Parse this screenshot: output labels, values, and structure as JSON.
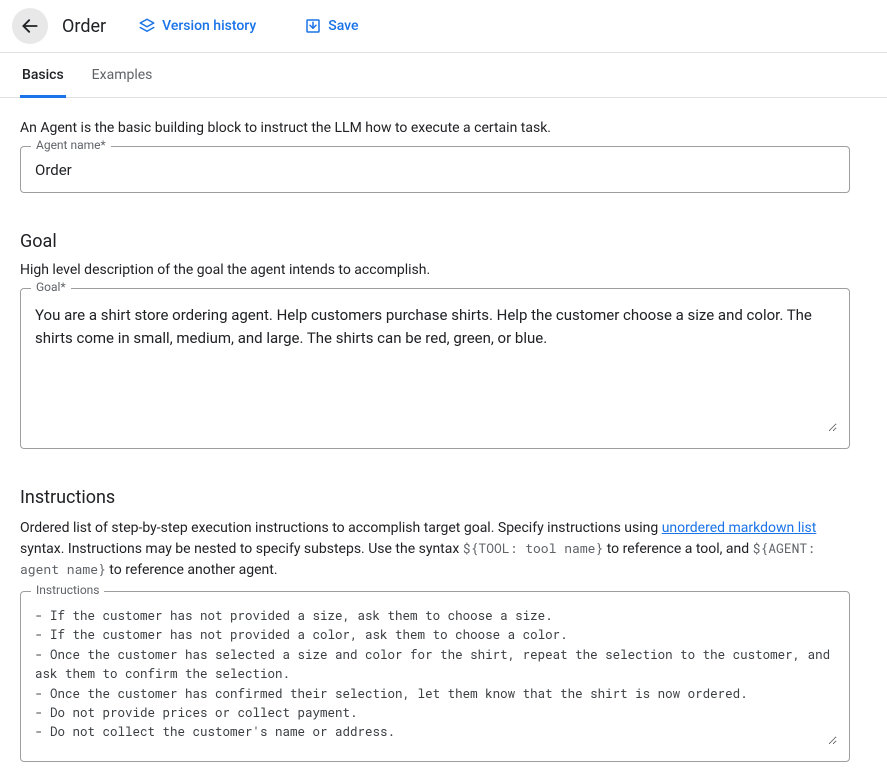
{
  "header": {
    "title": "Order",
    "version_history_label": "Version history",
    "save_label": "Save"
  },
  "tabs": {
    "basics": "Basics",
    "examples": "Examples",
    "active": "basics"
  },
  "intro": {
    "text": "An Agent is the basic building block to instruct the LLM how to execute a certain task."
  },
  "agent_name": {
    "label": "Agent name*",
    "value": "Order"
  },
  "goal": {
    "section_title": "Goal",
    "description": "High level description of the goal the agent intends to accomplish.",
    "label": "Goal*",
    "value": "You are a shirt store ordering agent. Help customers purchase shirts. Help the customer choose a size and color. The shirts come in small, medium, and large. The shirts can be red, green, or blue."
  },
  "instructions": {
    "section_title": "Instructions",
    "desc_prefix": "Ordered list of step-by-step execution instructions to accomplish target goal. Specify instructions using ",
    "link_text": "unordered markdown list",
    "desc_mid1": " syntax. Instructions may be nested to specify substeps. Use the syntax ",
    "code1": "${TOOL: tool name}",
    "desc_mid2": " to reference a tool, and ",
    "code2": "${AGENT: agent name}",
    "desc_end": " to reference another agent.",
    "label": "Instructions",
    "value": "- If the customer has not provided a size, ask them to choose a size.\n- If the customer has not provided a color, ask them to choose a color.\n- Once the customer has selected a size and color for the shirt, repeat the selection to the customer, and ask them to confirm the selection.\n- Once the customer has confirmed their selection, let them know that the shirt is now ordered.\n- Do not provide prices or collect payment.\n- Do not collect the customer's name or address."
  }
}
